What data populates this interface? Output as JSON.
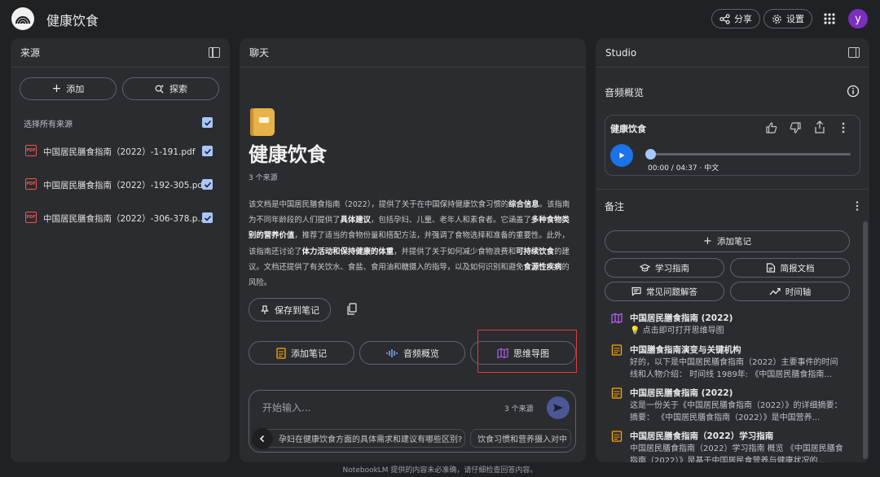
{
  "header": {
    "title": "健康饮食",
    "share_label": "分享",
    "settings_label": "设置",
    "avatar_letter": "y"
  },
  "sources_panel": {
    "title": "来源",
    "add_label": "添加",
    "explore_label": "探索",
    "select_all_label": "选择所有来源",
    "items": [
      {
        "label": "中国居民膳食指南（2022）-1-191.pdf",
        "checked": true
      },
      {
        "label": "中国居民膳食指南（2022）-192-305.pdf",
        "checked": true
      },
      {
        "label": "中国居民膳食指南（2022）-306-378.p...",
        "checked": true
      }
    ]
  },
  "chat_panel": {
    "title": "聊天",
    "notebook_title": "健康饮食",
    "source_count": "3 个来源",
    "summary_parts": [
      {
        "text": "该文档是中国居民膳食指南（2022），提供了关于在中国保持健康饮食习惯的",
        "bold": false
      },
      {
        "text": "综合信息",
        "bold": true
      },
      {
        "text": "。该指南为不同年龄段的人们提供了",
        "bold": false
      },
      {
        "text": "具体建议",
        "bold": true
      },
      {
        "text": "，包括孕妇、儿童、老年人和素食者。它涵盖了",
        "bold": false
      },
      {
        "text": "多种食物类别的营养价值",
        "bold": true
      },
      {
        "text": "，推荐了适当的食物份量和搭配方法，并强调了食物选择和准备的重要性。此外，该指南还讨论了",
        "bold": false
      },
      {
        "text": "体力活动和保持健康的体重",
        "bold": true
      },
      {
        "text": "，并提供了关于如何减少食物浪费和",
        "bold": false
      },
      {
        "text": "可持续饮食",
        "bold": true
      },
      {
        "text": "的建议。文档还提供了有关饮水、食盐、食用油和糖摄入的指导，以及如何识别和避免",
        "bold": false
      },
      {
        "text": "食源性疾病",
        "bold": true
      },
      {
        "text": "的风险。",
        "bold": false
      }
    ],
    "save_note_label": "保存到笔记",
    "add_note_label": "添加笔记",
    "audio_overview_label": "音频概览",
    "mind_map_label": "思维导图",
    "input_placeholder": "开始输入...",
    "input_source_count": "3 个来源",
    "suggestions": [
      "孕妇在健康饮食方面的具体需求和建议有哪些区别?",
      "饮食习惯和营养摄入对中"
    ]
  },
  "studio_panel": {
    "title": "Studio",
    "audio_section_title": "音频概览",
    "audio_title": "健康饮食",
    "audio_time": "00:00 / 04:37 · 中文",
    "audio_progress": 0,
    "notes_title": "备注",
    "add_note_label": "添加笔记",
    "buttons": {
      "study_guide": "学习指南",
      "briefing_doc": "简报文档",
      "faq": "常见问题解答",
      "timeline": "时间轴"
    },
    "notes": [
      {
        "icon": "map-icon",
        "title": "中国居民膳食指南 (2022)",
        "body": "💡 点击即可打开思维导图"
      },
      {
        "icon": "note-icon",
        "title": "中国膳食指南演变与关键机构",
        "body": "好的，以下是中国居民膳食指南（2022）主要事件的时间线和人物介绍： 时间线 1989年: 《中国居民膳食指南..."
      },
      {
        "icon": "note-icon",
        "title": "中国居民膳食指南 (2022)",
        "body": "这是一份关于《中国居民膳食指南（2022）》的详细摘要： 摘要： 《中国居民膳食指南（2022）》是中国营养..."
      },
      {
        "icon": "note-icon",
        "title": "中国居民膳食指南（2022）学习指南",
        "body": "中国居民膳食指南（2022）学习指南 概览 《中国居民膳食指南（2022）》是基于中国居民食营养与健康状况的..."
      }
    ]
  },
  "footer": {
    "disclaimer": "NotebookLM 提供的内容未必准确，请仔细检查回答内容。"
  },
  "colors": {
    "background": "#202124",
    "panel": "#2b2c30",
    "accent_blue": "#1a73e8",
    "highlight_red": "#e53935",
    "note_yellow": "#f9ab00",
    "mindmap_purple": "#b05cf0",
    "avatar_purple": "#7b2fbf"
  }
}
